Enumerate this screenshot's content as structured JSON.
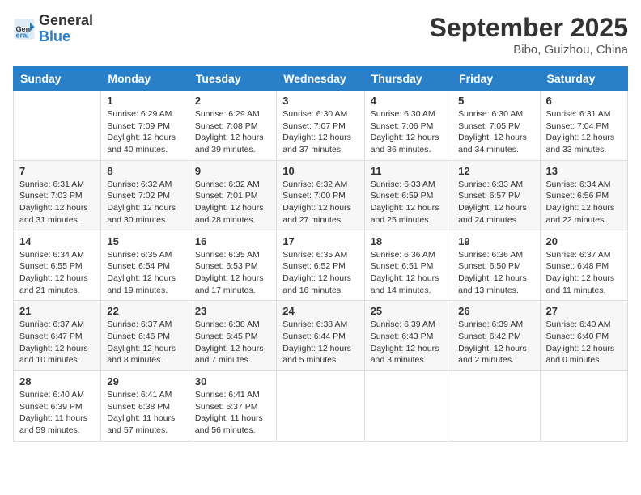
{
  "header": {
    "logo_general": "General",
    "logo_blue": "Blue",
    "month_title": "September 2025",
    "location": "Bibo, Guizhou, China"
  },
  "weekdays": [
    "Sunday",
    "Monday",
    "Tuesday",
    "Wednesday",
    "Thursday",
    "Friday",
    "Saturday"
  ],
  "weeks": [
    [
      {
        "day": "",
        "info": ""
      },
      {
        "day": "1",
        "info": "Sunrise: 6:29 AM\nSunset: 7:09 PM\nDaylight: 12 hours\nand 40 minutes."
      },
      {
        "day": "2",
        "info": "Sunrise: 6:29 AM\nSunset: 7:08 PM\nDaylight: 12 hours\nand 39 minutes."
      },
      {
        "day": "3",
        "info": "Sunrise: 6:30 AM\nSunset: 7:07 PM\nDaylight: 12 hours\nand 37 minutes."
      },
      {
        "day": "4",
        "info": "Sunrise: 6:30 AM\nSunset: 7:06 PM\nDaylight: 12 hours\nand 36 minutes."
      },
      {
        "day": "5",
        "info": "Sunrise: 6:30 AM\nSunset: 7:05 PM\nDaylight: 12 hours\nand 34 minutes."
      },
      {
        "day": "6",
        "info": "Sunrise: 6:31 AM\nSunset: 7:04 PM\nDaylight: 12 hours\nand 33 minutes."
      }
    ],
    [
      {
        "day": "7",
        "info": "Sunrise: 6:31 AM\nSunset: 7:03 PM\nDaylight: 12 hours\nand 31 minutes."
      },
      {
        "day": "8",
        "info": "Sunrise: 6:32 AM\nSunset: 7:02 PM\nDaylight: 12 hours\nand 30 minutes."
      },
      {
        "day": "9",
        "info": "Sunrise: 6:32 AM\nSunset: 7:01 PM\nDaylight: 12 hours\nand 28 minutes."
      },
      {
        "day": "10",
        "info": "Sunrise: 6:32 AM\nSunset: 7:00 PM\nDaylight: 12 hours\nand 27 minutes."
      },
      {
        "day": "11",
        "info": "Sunrise: 6:33 AM\nSunset: 6:59 PM\nDaylight: 12 hours\nand 25 minutes."
      },
      {
        "day": "12",
        "info": "Sunrise: 6:33 AM\nSunset: 6:57 PM\nDaylight: 12 hours\nand 24 minutes."
      },
      {
        "day": "13",
        "info": "Sunrise: 6:34 AM\nSunset: 6:56 PM\nDaylight: 12 hours\nand 22 minutes."
      }
    ],
    [
      {
        "day": "14",
        "info": "Sunrise: 6:34 AM\nSunset: 6:55 PM\nDaylight: 12 hours\nand 21 minutes."
      },
      {
        "day": "15",
        "info": "Sunrise: 6:35 AM\nSunset: 6:54 PM\nDaylight: 12 hours\nand 19 minutes."
      },
      {
        "day": "16",
        "info": "Sunrise: 6:35 AM\nSunset: 6:53 PM\nDaylight: 12 hours\nand 17 minutes."
      },
      {
        "day": "17",
        "info": "Sunrise: 6:35 AM\nSunset: 6:52 PM\nDaylight: 12 hours\nand 16 minutes."
      },
      {
        "day": "18",
        "info": "Sunrise: 6:36 AM\nSunset: 6:51 PM\nDaylight: 12 hours\nand 14 minutes."
      },
      {
        "day": "19",
        "info": "Sunrise: 6:36 AM\nSunset: 6:50 PM\nDaylight: 12 hours\nand 13 minutes."
      },
      {
        "day": "20",
        "info": "Sunrise: 6:37 AM\nSunset: 6:48 PM\nDaylight: 12 hours\nand 11 minutes."
      }
    ],
    [
      {
        "day": "21",
        "info": "Sunrise: 6:37 AM\nSunset: 6:47 PM\nDaylight: 12 hours\nand 10 minutes."
      },
      {
        "day": "22",
        "info": "Sunrise: 6:37 AM\nSunset: 6:46 PM\nDaylight: 12 hours\nand 8 minutes."
      },
      {
        "day": "23",
        "info": "Sunrise: 6:38 AM\nSunset: 6:45 PM\nDaylight: 12 hours\nand 7 minutes."
      },
      {
        "day": "24",
        "info": "Sunrise: 6:38 AM\nSunset: 6:44 PM\nDaylight: 12 hours\nand 5 minutes."
      },
      {
        "day": "25",
        "info": "Sunrise: 6:39 AM\nSunset: 6:43 PM\nDaylight: 12 hours\nand 3 minutes."
      },
      {
        "day": "26",
        "info": "Sunrise: 6:39 AM\nSunset: 6:42 PM\nDaylight: 12 hours\nand 2 minutes."
      },
      {
        "day": "27",
        "info": "Sunrise: 6:40 AM\nSunset: 6:40 PM\nDaylight: 12 hours\nand 0 minutes."
      }
    ],
    [
      {
        "day": "28",
        "info": "Sunrise: 6:40 AM\nSunset: 6:39 PM\nDaylight: 11 hours\nand 59 minutes."
      },
      {
        "day": "29",
        "info": "Sunrise: 6:41 AM\nSunset: 6:38 PM\nDaylight: 11 hours\nand 57 minutes."
      },
      {
        "day": "30",
        "info": "Sunrise: 6:41 AM\nSunset: 6:37 PM\nDaylight: 11 hours\nand 56 minutes."
      },
      {
        "day": "",
        "info": ""
      },
      {
        "day": "",
        "info": ""
      },
      {
        "day": "",
        "info": ""
      },
      {
        "day": "",
        "info": ""
      }
    ]
  ]
}
